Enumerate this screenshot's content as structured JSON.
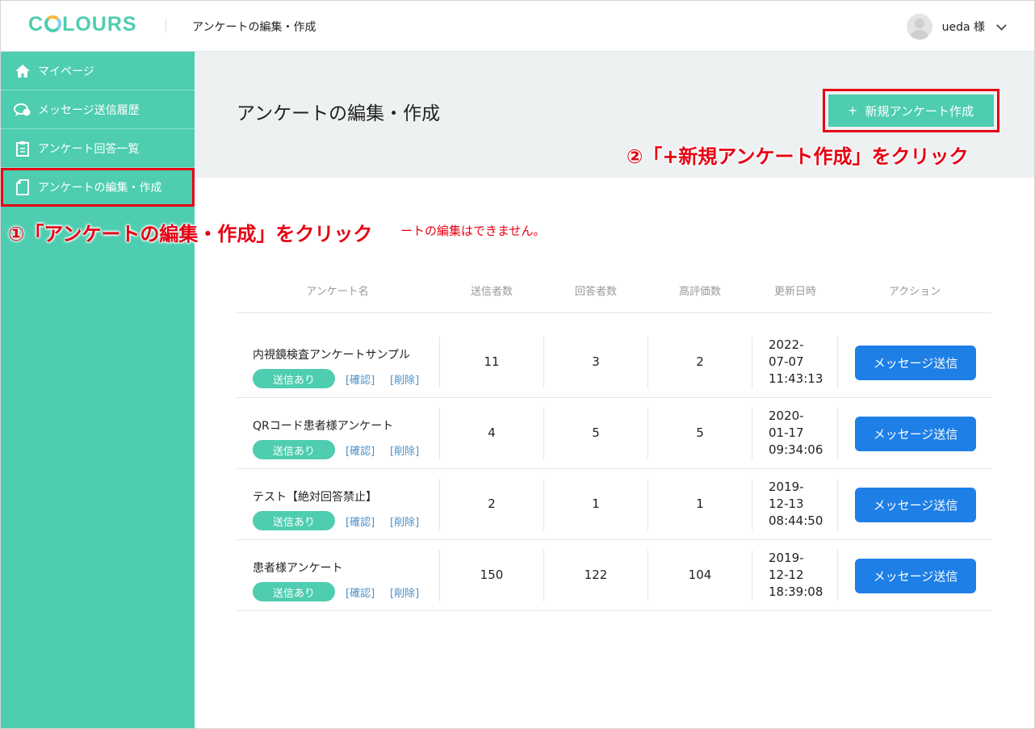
{
  "colors": {
    "accent": "#4ecdb0",
    "annotation": "#e60012",
    "primary_button": "#1e7fe6",
    "link": "#4a90c8"
  },
  "header": {
    "logo_prefix": "C",
    "logo_suffix": "LOURS",
    "title": "アンケートの編集・作成",
    "user_name": "ueda 様"
  },
  "sidebar": {
    "items": [
      {
        "label": "マイページ",
        "icon": "home-icon"
      },
      {
        "label": "メッセージ送信履歴",
        "icon": "chat-bubble-icon"
      },
      {
        "label": "アンケート回答一覧",
        "icon": "clipboard-icon"
      },
      {
        "label": "アンケートの編集・作成",
        "icon": "document-icon"
      }
    ]
  },
  "main": {
    "page_title": "アンケートの編集・作成",
    "new_button_label": "新規アンケート作成",
    "warning": "ートの編集はできません。"
  },
  "annotations": {
    "step1": "①「アンケートの編集・作成」をクリック",
    "step2": "②「+新規アンケート作成」をクリック"
  },
  "table": {
    "headers": [
      "アンケート名",
      "送信者数",
      "回答者数",
      "高評価数",
      "更新日時",
      "アクション"
    ],
    "rows": [
      {
        "name": "内視鏡検査アンケートサンプル",
        "status": "送信あり",
        "confirm": "[確認]",
        "delete": "[削除]",
        "sent": "11",
        "answered": "3",
        "high": "2",
        "date_l1": "2022-",
        "date_l2": "07-07",
        "date_l3": "11:43:13",
        "action": "メッセージ送信"
      },
      {
        "name": "QRコード患者様アンケート",
        "status": "送信あり",
        "confirm": "[確認]",
        "delete": "[削除]",
        "sent": "4",
        "answered": "5",
        "high": "5",
        "date_l1": "2020-",
        "date_l2": "01-17",
        "date_l3": "09:34:06",
        "action": "メッセージ送信"
      },
      {
        "name": "テスト【絶対回答禁止】",
        "status": "送信あり",
        "confirm": "[確認]",
        "delete": "[削除]",
        "sent": "2",
        "answered": "1",
        "high": "1",
        "date_l1": "2019-",
        "date_l2": "12-13",
        "date_l3": "08:44:50",
        "action": "メッセージ送信"
      },
      {
        "name": "患者様アンケート",
        "status": "送信あり",
        "confirm": "[確認]",
        "delete": "[削除]",
        "sent": "150",
        "answered": "122",
        "high": "104",
        "date_l1": "2019-",
        "date_l2": "12-12",
        "date_l3": "18:39:08",
        "action": "メッセージ送信"
      }
    ]
  }
}
